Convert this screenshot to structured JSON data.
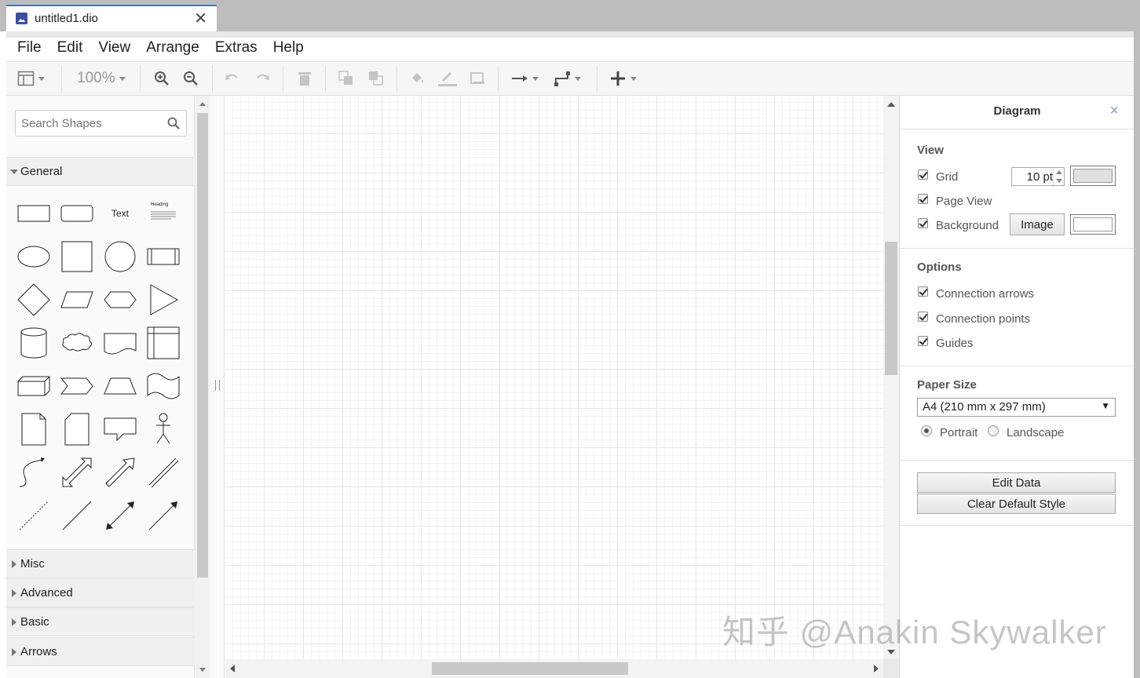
{
  "tab": {
    "title": "untitled1.dio",
    "close": "✕"
  },
  "menu": [
    "File",
    "Edit",
    "View",
    "Arrange",
    "Extras",
    "Help"
  ],
  "toolbar": {
    "zoom": "100%",
    "icons": [
      "format-panel-icon",
      "zoom-in-icon",
      "zoom-out-icon",
      "undo-icon",
      "redo-icon",
      "delete-icon",
      "to-front-icon",
      "to-back-icon",
      "fill-color-icon",
      "line-color-icon",
      "shadow-icon",
      "connection-icon",
      "waypoints-icon",
      "insert-icon"
    ]
  },
  "sidebar": {
    "search_placeholder": "Search Shapes",
    "general_label": "General",
    "text_shape": "Text",
    "heading_shape": "Heading",
    "sections": [
      "Misc",
      "Advanced",
      "Basic",
      "Arrows"
    ]
  },
  "panel": {
    "title": "Diagram",
    "close": "×",
    "view": {
      "heading": "View",
      "grid_label": "Grid",
      "grid_checked": true,
      "grid_size": "10 pt",
      "grid_color": "#e0e0e0",
      "page_view_label": "Page View",
      "page_view_checked": true,
      "background_label": "Background",
      "background_checked": true,
      "image_button": "Image",
      "background_color": "#ffffff"
    },
    "options": {
      "heading": "Options",
      "connection_arrows": "Connection arrows",
      "connection_points": "Connection points",
      "guides": "Guides"
    },
    "paper": {
      "heading": "Paper Size",
      "selected": "A4 (210 mm x 297 mm)",
      "portrait": "Portrait",
      "landscape": "Landscape",
      "orientation": "Portrait"
    },
    "buttons": {
      "edit_data": "Edit Data",
      "clear_style": "Clear Default Style"
    }
  },
  "watermark": "知乎 @Anakin Skywalker",
  "colors": {
    "accent": "#2c7be5",
    "grid_major": "#e6e6e6",
    "grid_minor": "#f3f3f3"
  }
}
